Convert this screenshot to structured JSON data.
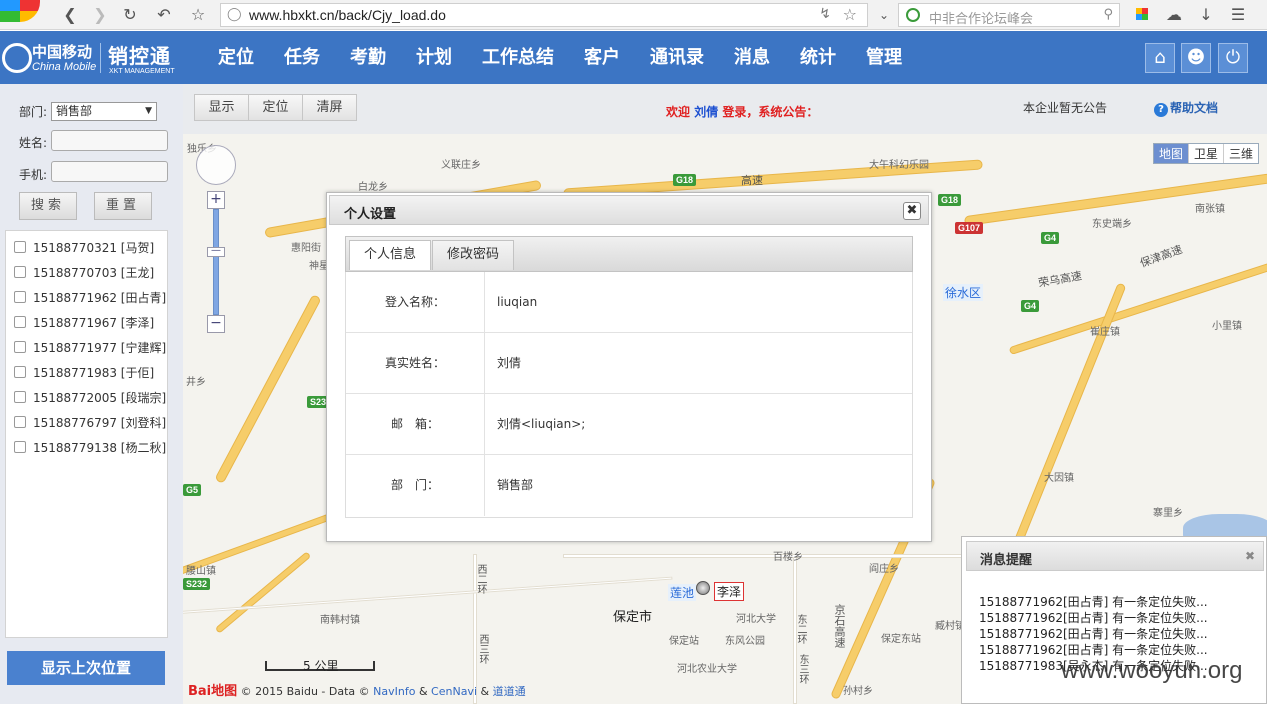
{
  "browser": {
    "url": "www.hbxkt.cn/back/Cjy_load.do",
    "search_placeholder": "中非合作论坛峰会"
  },
  "header": {
    "logo_cn": "中国移动",
    "logo_en": "China Mobile",
    "app_name": "销控通",
    "app_name_en": "XKT MANAGEMENT",
    "nav": [
      "定位",
      "任务",
      "考勤",
      "计划",
      "工作总结",
      "客户",
      "通讯录",
      "消息",
      "统计",
      "管理"
    ]
  },
  "left": {
    "dept_label": "部门:",
    "dept_value": "销售部",
    "name_label": "姓名:",
    "phone_label": "手机:",
    "search_btn": "搜索",
    "reset_btn": "重置",
    "users": [
      "15188770321 [马贺]",
      "15188770703 [王龙]",
      "15188771962 [田占青]",
      "15188771967 [李泽]",
      "15188771977 [宁建辉]",
      "15188771983 [于佢]",
      "15188772005 [段瑞宗]",
      "15188776797 [刘登科]",
      "15188779138 [杨二秋]"
    ],
    "show_last_btn": "显示上次位置"
  },
  "toolbar": {
    "show": "显示",
    "locate": "定位",
    "clear": "清屏",
    "welcome_pre": "欢迎",
    "welcome_name": "刘倩",
    "welcome_post": "登录，系统公告：",
    "notice": "本企业暂无公告",
    "help": "帮助文档"
  },
  "map": {
    "types": [
      "地图",
      "卫星",
      "三维"
    ],
    "scale": "5 公里",
    "copyright_logo": "Bai地图",
    "copyright_text": "© 2015 Baidu - Data ©",
    "cp_navinfo": "NavInfo",
    "cp_amp": "&",
    "cp_cennavi": "CenNavi",
    "cp_amp2": "&",
    "cp_ddg": "道道通",
    "marker_label": "李泽",
    "labels": {
      "zhuqiu": "独乐乡",
      "yilian": "义联庄乡",
      "bailong": "白龙乡",
      "huiyang": "惠阳街",
      "shenxing": "神星",
      "jingxiang": "井乡",
      "daniu": "大午科幻乐园",
      "dongshi": "东史端乡",
      "nanzhang": "南张镇",
      "xushui": "徐水区",
      "cuizhuang": "崔庄镇",
      "xiaoli": "小里镇",
      "daying": "大因镇",
      "zhaiwang": "寨里乡",
      "baoding": "保定市",
      "hebei": "河北大学",
      "baodingzhan": "保定站",
      "dongfeng": "东风公园",
      "baodingdong": "保定东站",
      "hebeinong": "河北农业大学",
      "lianchi": "莲池",
      "baishan": "腰山镇",
      "nanhan": "南韩村镇",
      "baita": "百楼乡",
      "yanzhuang": "阎庄乡",
      "sunzhuang": "孙村乡",
      "zangcun": "臧村镇",
      "rongwu": "荣乌高速",
      "baojin": "保津高速",
      "jingshi": "京石高速",
      "gaosu": "高速",
      "xierhuan": "西二环",
      "dongerhuan": "东二环",
      "xisanhuan": "西三环",
      "dongsanhuan": "东三环"
    },
    "shields": {
      "g18a": "G18",
      "g18b": "G18",
      "g4a": "G4",
      "g4b": "G4",
      "g107": "G107",
      "s232": "S232",
      "s23": "S23",
      "g5": "G5"
    }
  },
  "dialog": {
    "title": "个人设置",
    "tabs": [
      "个人信息",
      "修改密码"
    ],
    "rows": [
      {
        "key": "登入名称：",
        "value": "liuqian"
      },
      {
        "key": "真实姓名：",
        "value": "刘倩"
      },
      {
        "key": "邮　箱：",
        "value": "刘倩<liuqian>;"
      },
      {
        "key": "部　门：",
        "value": "销售部"
      }
    ]
  },
  "messages": {
    "title": "消息提醒",
    "lines": [
      "15188771962[田占青] 有一条定位失败...",
      "15188771962[田占青] 有一条定位失败...",
      "15188771962[田占青] 有一条定位失败...",
      "15188771962[田占青] 有一条定位失败...",
      "15188771983[吴永杰] 有一条定位失败..."
    ]
  },
  "watermark": "www.wooyun.org"
}
